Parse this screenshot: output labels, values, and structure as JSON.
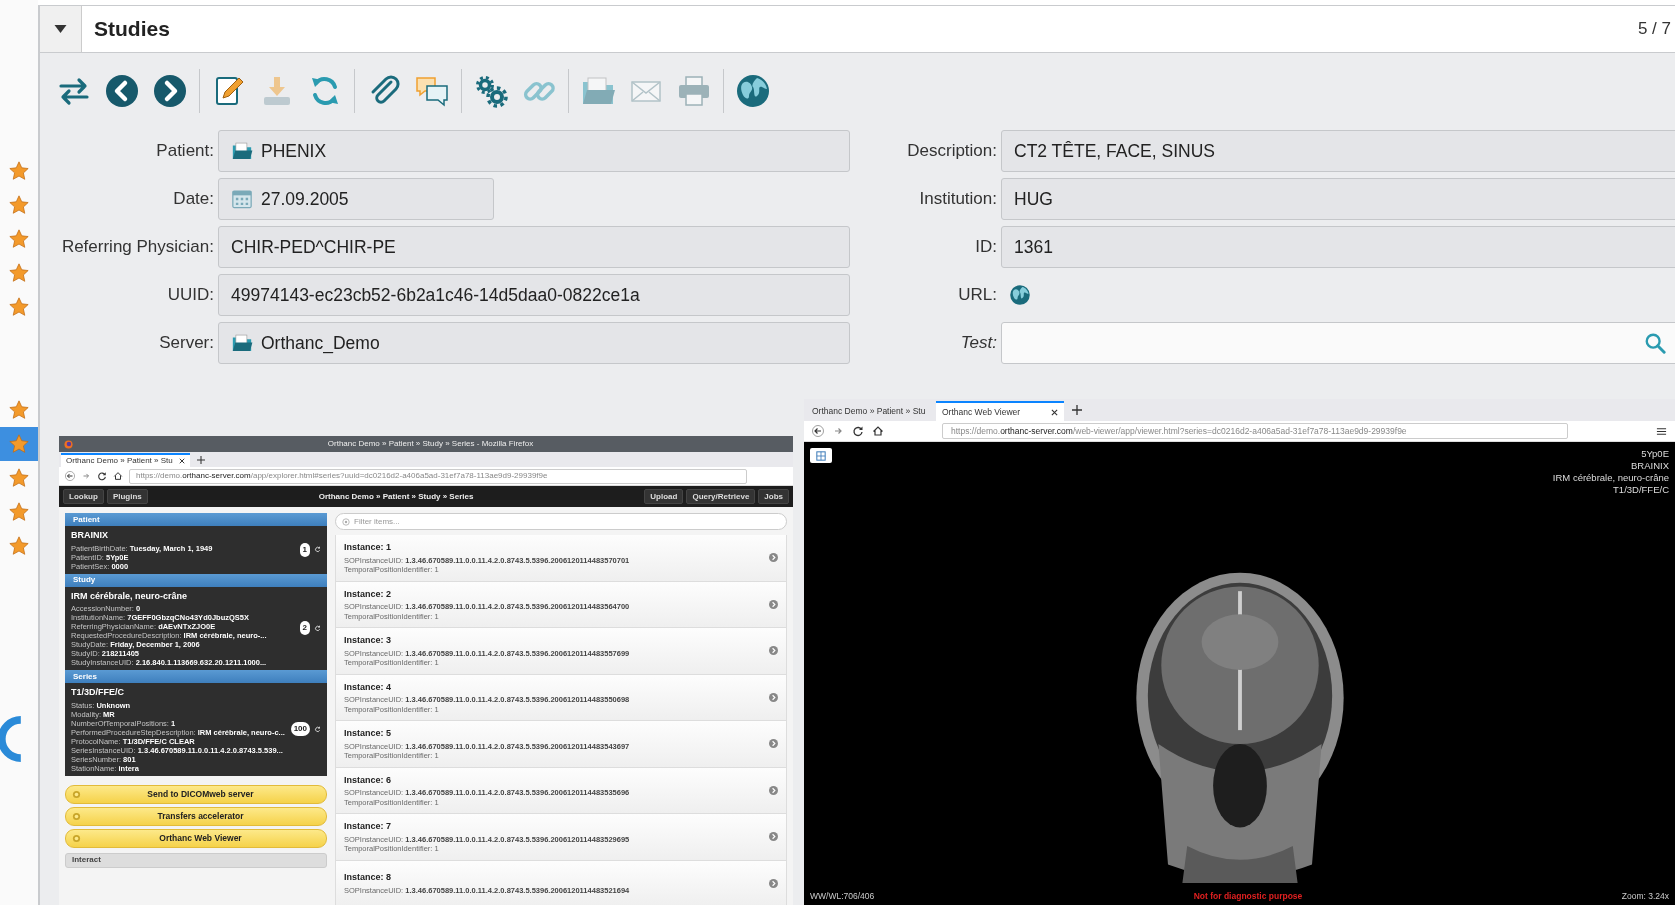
{
  "rail": {
    "star_groups": [
      [
        {
          "selected": false
        },
        {
          "selected": false
        },
        {
          "selected": false
        },
        {
          "selected": false
        },
        {
          "selected": false
        }
      ],
      [
        {
          "selected": false
        },
        {
          "selected": true
        },
        {
          "selected": false
        },
        {
          "selected": false
        },
        {
          "selected": false
        }
      ]
    ]
  },
  "header": {
    "title": "Studies",
    "counter": "5 / 7"
  },
  "toolbar": [
    [
      {
        "kind": "swap",
        "disabled": false
      },
      {
        "kind": "previous",
        "disabled": false
      },
      {
        "kind": "next",
        "disabled": false
      }
    ],
    [
      {
        "kind": "edit",
        "disabled": false
      },
      {
        "kind": "download",
        "disabled": true
      },
      {
        "kind": "refresh",
        "disabled": false
      }
    ],
    [
      {
        "kind": "attach",
        "disabled": false
      },
      {
        "kind": "comments",
        "disabled": false
      }
    ],
    [
      {
        "kind": "gears",
        "disabled": false
      },
      {
        "kind": "link",
        "disabled": true
      }
    ],
    [
      {
        "kind": "folder",
        "disabled": true
      },
      {
        "kind": "mail",
        "disabled": true
      },
      {
        "kind": "print",
        "disabled": true
      }
    ],
    [
      {
        "kind": "globe",
        "disabled": false
      }
    ]
  ],
  "form": {
    "left": [
      {
        "label": "Patient:",
        "value": "PHENIX",
        "kind": "text"
      },
      {
        "label": "Date:",
        "value": "27.09.2005",
        "kind": "date"
      },
      {
        "label": "Referring Physician:",
        "value": "CHIR-PED^CHIR-PE",
        "kind": "text"
      },
      {
        "label": "UUID:",
        "value": "49974143-ec23cb52-6b2a1c46-14d5daa0-0822ce1a",
        "kind": "text"
      },
      {
        "label": "Server:",
        "value": "Orthanc_Demo",
        "kind": "text"
      }
    ],
    "right": [
      {
        "label": "Description:",
        "value": "CT2 TÊTE, FACE, SINUS",
        "kind": "text",
        "italic": false
      },
      {
        "label": "Institution:",
        "value": "HUG",
        "kind": "text",
        "italic": false
      },
      {
        "label": "ID:",
        "value": "1361",
        "kind": "text",
        "italic": false
      },
      {
        "label": "URL:",
        "kind": "link",
        "italic": false
      },
      {
        "label": "Test:",
        "kind": "search",
        "italic": true
      }
    ]
  },
  "explorer_screenshot": {
    "window_title": "Orthanc Demo » Patient » Study » Series - Mozilla Firefox",
    "tabs": [
      {
        "label": "Orthanc Demo » Patient » Stu",
        "selected": true
      }
    ],
    "url": "https://demo.**orthanc-server.com**/app/explorer.html#series?uuid=dc0216d2-a406a5ad-31ef7a78-113ae9d9-29939f9e",
    "nav_left": [
      "Lookup",
      "Plugins"
    ],
    "nav_title": "Orthanc Demo » Patient » Study » Series",
    "nav_right": [
      "Upload",
      "Query/Retrieve",
      "Jobs"
    ],
    "sidebar": [
      {
        "heading": "Patient",
        "title": "BRAINIX",
        "badge": "1",
        "lines": [
          "PatientBirthDate: **Tuesday, March 1, 1949**",
          "PatientID: **5Yp0E**",
          "PatientSex: **0000**"
        ]
      },
      {
        "heading": "Study",
        "title": "IRM cérébrale, neuro-crâne",
        "badge": "2",
        "lines": [
          "AccessionNumber: **0**",
          "InstitutionName: **7GEFF0GbzqCNo43Yd0JbuzQS5X**",
          "ReferringPhysicianName: **dAEvNTxZJO0E**",
          "RequestedProcedureDescription: **IRM cérébrale, neuro-...**",
          "StudyDate: **Friday, December 1, 2006**",
          "StudyID: **218211405**",
          "StudyInstanceUID: **2.16.840.1.113669.632.20.1211.1000...**"
        ]
      },
      {
        "heading": "Series",
        "title": "T1/3D/FFE/C",
        "badge": "100",
        "lines": [
          "Status: **Unknown**",
          "Modality: **MR**",
          "NumberOfTemporalPositions: **1**",
          "PerformedProcedureStepDescription: **IRM cérébrale, neuro-c...**",
          "ProtocolName: **T1/3D/FFE/C CLEAR**",
          "SeriesInstanceUID: **1.3.46.670589.11.0.0.11.4.2.0.8743.5.539...**",
          "SeriesNumber: **801**",
          "StationName: **intera**"
        ]
      }
    ],
    "actions": [
      "Send to DICOMweb server",
      "Transfers accelerator",
      "Orthanc Web Viewer"
    ],
    "interact": "Interact",
    "filter_placeholder": "Filter items...",
    "instances": [
      {
        "title": "Instance: 1",
        "lines": [
          "SOPInstanceUID: **1.3.46.670589.11.0.0.11.4.2.0.8743.5.5396.2006120114483570701**",
          "TemporalPositionIdentifier: 1"
        ]
      },
      {
        "title": "Instance: 2",
        "lines": [
          "SOPInstanceUID: **1.3.46.670589.11.0.0.11.4.2.0.8743.5.5396.2006120114483564700**",
          "TemporalPositionIdentifier: 1"
        ]
      },
      {
        "title": "Instance: 3",
        "lines": [
          "SOPInstanceUID: **1.3.46.670589.11.0.0.11.4.2.0.8743.5.5396.2006120114483557699**",
          "TemporalPositionIdentifier: 1"
        ]
      },
      {
        "title": "Instance: 4",
        "lines": [
          "SOPInstanceUID: **1.3.46.670589.11.0.0.11.4.2.0.8743.5.5396.2006120114483550698**",
          "TemporalPositionIdentifier: 1"
        ]
      },
      {
        "title": "Instance: 5",
        "lines": [
          "SOPInstanceUID: **1.3.46.670589.11.0.0.11.4.2.0.8743.5.5396.2006120114483543697**",
          "TemporalPositionIdentifier: 1"
        ]
      },
      {
        "title": "Instance: 6",
        "lines": [
          "SOPInstanceUID: **1.3.46.670589.11.0.0.11.4.2.0.8743.5.5396.2006120114483535696**",
          "TemporalPositionIdentifier: 1"
        ]
      },
      {
        "title": "Instance: 7",
        "lines": [
          "SOPInstanceUID: **1.3.46.670589.11.0.0.11.4.2.0.8743.5.5396.2006120114483529695**",
          "TemporalPositionIdentifier: 1"
        ]
      },
      {
        "title": "Instance: 8",
        "lines": [
          "SOPInstanceUID: **1.3.46.670589.11.0.0.11.4.2.0.8743.5.5396.2006120114483521694**"
        ]
      }
    ]
  },
  "viewer_screenshot": {
    "tabs": [
      {
        "label": "Orthanc Demo » Patient » Stu",
        "selected": false
      },
      {
        "label": "Orthanc Web Viewer",
        "selected": true
      }
    ],
    "url": "https://demo.**orthanc-server.com**/web-viewer/app/viewer.html?series=dc0216d2-a406a5ad-31ef7a78-113ae9d9-29939f9e",
    "overlay_lines": [
      "5Yp0E",
      "BRAINIX",
      "IRM cérébrale, neuro-crâne",
      "T1/3D/FFE/C"
    ],
    "window_level": "WW/WL:706/406",
    "warning": "Not for diagnostic purpose",
    "zoom": "Zoom: 3.24x"
  }
}
